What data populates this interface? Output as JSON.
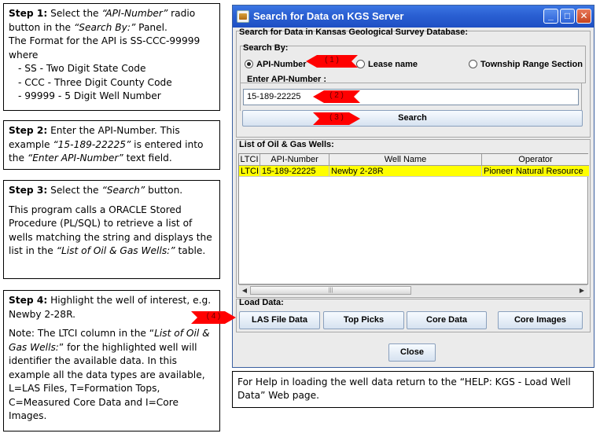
{
  "instructions": {
    "step1": {
      "label": "Step 1:",
      "text_a": " Select the ",
      "em_a": "“API-Number”",
      "text_b": " radio button in the ",
      "em_b": "“Search By:”",
      "text_c": " Panel.",
      "line2": "The Format for the API is SS-CCC-99999 where",
      "items": [
        "- SS - Two Digit State Code",
        "- CCC - Three Digit County Code",
        "- 99999  - 5 Digit Well Number"
      ]
    },
    "step2": {
      "label": "Step 2:",
      "text_a": " Enter the API-Number. This example ",
      "em_a": "“15-189-22225”",
      "text_b": "  is entered into the ",
      "em_b": "“Enter API-Number”",
      "text_c": " text field."
    },
    "step3": {
      "label": "Step 3:",
      "text_a": " Select the ",
      "em_a": "“Search”",
      "text_b": " button.",
      "para2_a": "This program calls  a ORACLE Stored Procedure (PL/SQL) to retrieve a list of wells matching the string and displays the list in the ",
      "para2_em": "“List of Oil & Gas Wells:”",
      "para2_b": "  table."
    },
    "step4": {
      "label": "Step 4:",
      "text_a": " Highlight the well of interest, e.g. Newby 2-28R.",
      "para2_a": "Note: The LTCI column in the “",
      "para2_em": "List of Oil & Gas Wells:",
      "para2_b": "” for the highlighted well will identifier the available data. In this example all the data types are available, L=LAS Files, T=Formation Tops, C=Measured Core Data and I=Core Images."
    },
    "help": "For Help in loading the well data return to the “HELP: KGS - Load Well Data” Web page."
  },
  "window": {
    "title": "Search for Data on KGS Server",
    "controls": {
      "minimize": "_",
      "maximize": "□",
      "close": "✕"
    },
    "search_panel_label": "Search for Data in Kansas Geological Survey Database:",
    "search_by": {
      "label": "Search By:",
      "options": [
        "API-Number",
        "Lease name",
        "Township Range Section"
      ],
      "selected": "API-Number"
    },
    "api_field": {
      "label": "Enter API-Number :",
      "value": "15-189-22225"
    },
    "search_button": "Search",
    "wells": {
      "label": "List of Oil & Gas Wells:",
      "columns": [
        "LTCI",
        "API-Number",
        "Well Name",
        "Operator"
      ],
      "rows": [
        [
          "LTCI",
          "15-189-22225",
          "Newby 2-28R",
          "Pioneer Natural Resource"
        ]
      ],
      "highlight_color": "#ffff00"
    },
    "load_data": {
      "label": "Load Data:",
      "buttons": [
        "LAS File Data",
        "Top Picks",
        "Core Data",
        "Core Images"
      ]
    },
    "close_button": "Close"
  },
  "markers": [
    "( 1 )",
    "( 2 )",
    "( 3 )",
    "( 4 )"
  ],
  "colors": {
    "title_bar": "#2a5fd2",
    "marker": "#ff0000",
    "selected_row": "#ffff00"
  }
}
